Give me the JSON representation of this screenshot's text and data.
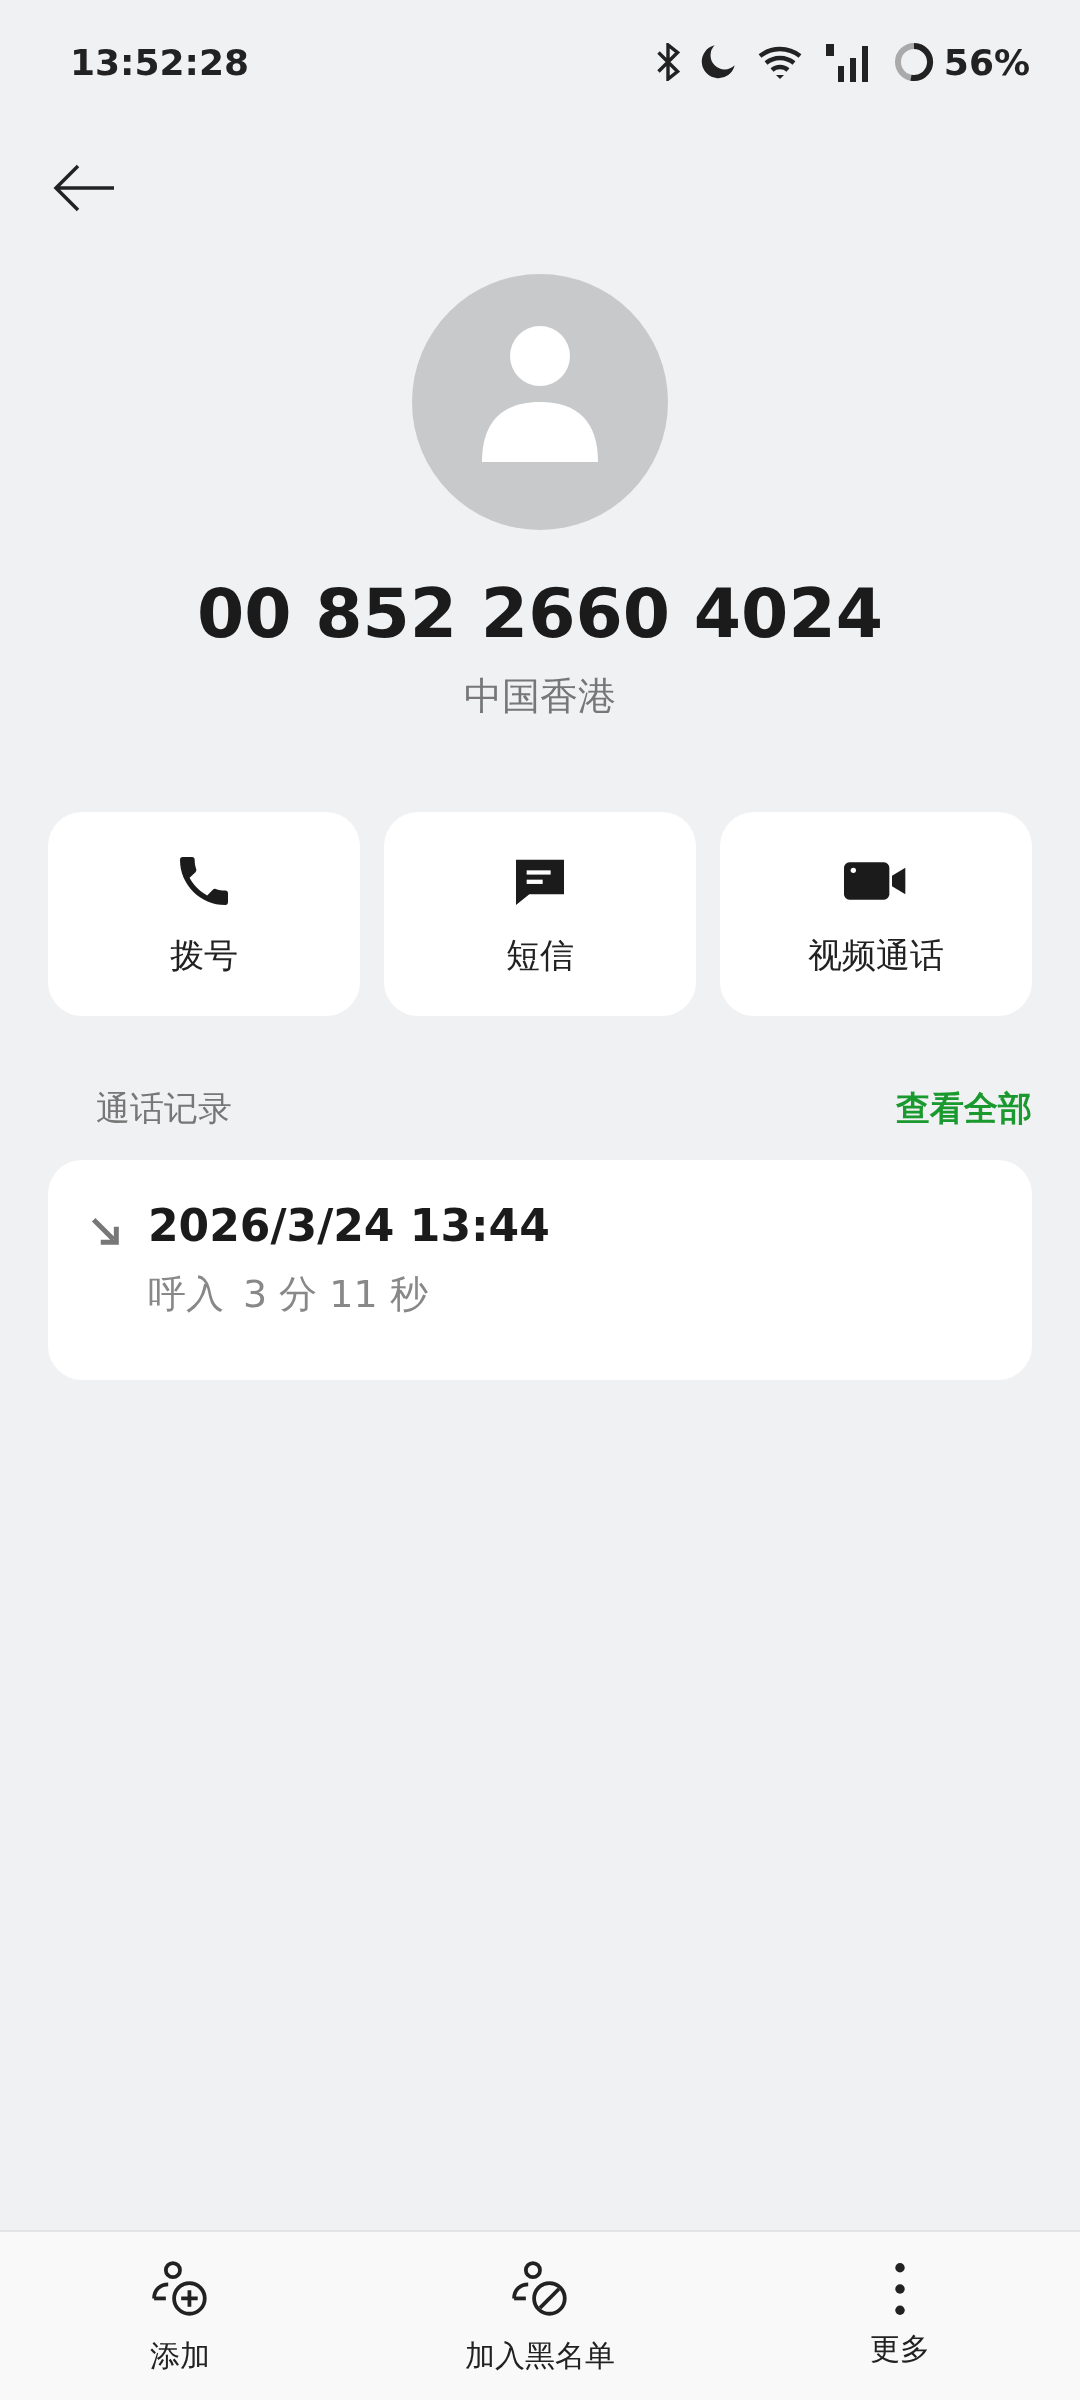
{
  "status_bar": {
    "time": "13:52:28",
    "battery": "56%"
  },
  "contact": {
    "number": "00 852 2660 4024",
    "region": "中国香港"
  },
  "actions": [
    {
      "kind": "call",
      "label": "拨号"
    },
    {
      "kind": "message",
      "label": "短信"
    },
    {
      "kind": "video",
      "label": "视频通话"
    }
  ],
  "call_log": {
    "title": "通话记录",
    "view_all": "查看全部",
    "entries": [
      {
        "kind": "incoming",
        "datetime": "2026/3/24 13:44",
        "type": "呼入",
        "duration": "3 分 11 秒"
      }
    ]
  },
  "bottom_bar": [
    {
      "kind": "add",
      "label": "添加"
    },
    {
      "kind": "block",
      "label": "加入黑名单"
    },
    {
      "kind": "more",
      "label": "更多"
    }
  ]
}
